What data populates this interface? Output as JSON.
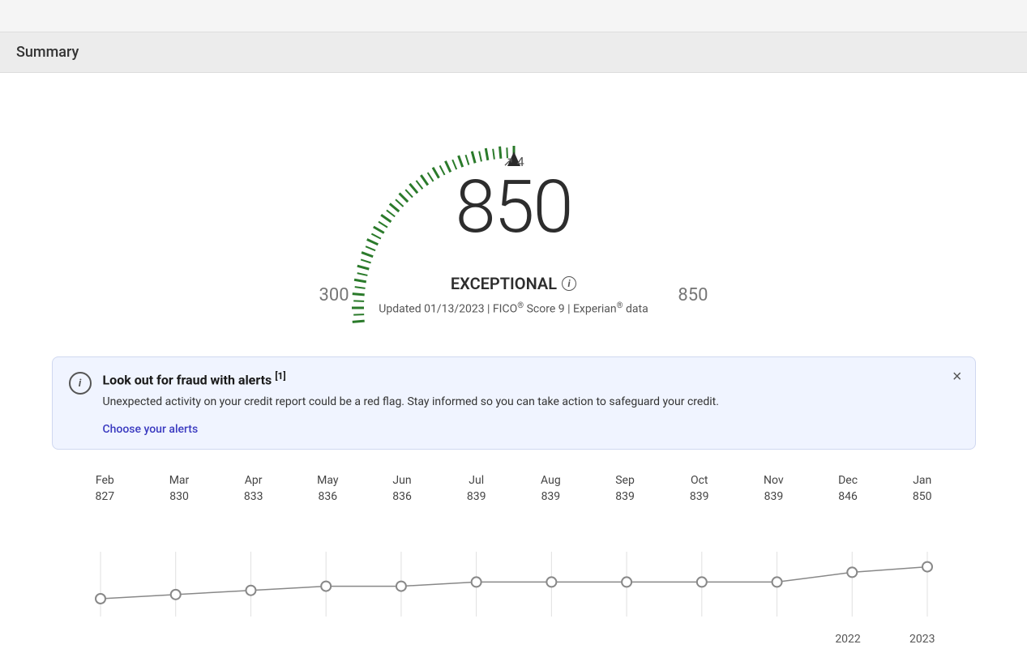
{
  "page": {
    "title": "Summary"
  },
  "score": {
    "value": "850",
    "change": "4",
    "change_direction": "up",
    "min": "300",
    "max": "850",
    "rating": "EXCEPTIONAL",
    "updated": "Updated 01/13/2023 | FICO",
    "fico_reg": "®",
    "score_type": "Score 9 | Experian",
    "experian_reg": "®",
    "data_label": "data"
  },
  "alert": {
    "title": "Look out for fraud with alerts",
    "footnote": "[1]",
    "body": "Unexpected activity on your credit report could be a red flag. Stay informed so you can take action to safeguard your credit.",
    "link_label": "Choose your alerts",
    "close_label": "×"
  },
  "chart": {
    "months": [
      {
        "month": "Feb",
        "score": "827"
      },
      {
        "month": "Mar",
        "score": "830"
      },
      {
        "month": "Apr",
        "score": "833"
      },
      {
        "month": "May",
        "score": "836"
      },
      {
        "month": "Jun",
        "score": "836"
      },
      {
        "month": "Jul",
        "score": "839"
      },
      {
        "month": "Aug",
        "score": "839"
      },
      {
        "month": "Sep",
        "score": "839"
      },
      {
        "month": "Oct",
        "score": "839"
      },
      {
        "month": "Nov",
        "score": "839"
      },
      {
        "month": "Dec",
        "score": "846"
      },
      {
        "month": "Jan",
        "score": "850"
      }
    ],
    "year_markers": [
      {
        "col_index": 10,
        "year": "2022"
      },
      {
        "col_index": 11,
        "year": "2023"
      }
    ]
  },
  "colors": {
    "gauge_green": "#2a7a2a",
    "gauge_gray": "#bbb",
    "score_text": "#2d2d2d",
    "accent_blue": "#3a3ac0",
    "alert_bg": "#f0f4ff"
  }
}
